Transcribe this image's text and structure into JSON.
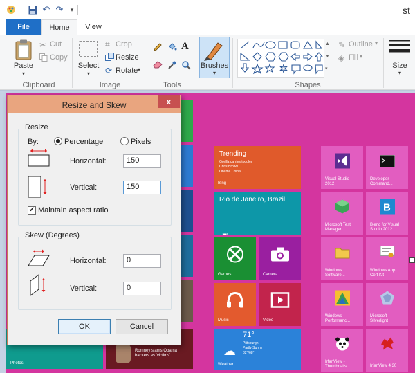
{
  "window": {
    "title": "st"
  },
  "tabs": {
    "file": "File",
    "home": "Home",
    "view": "View"
  },
  "ribbon": {
    "clipboard": {
      "paste": "Paste",
      "cut": "Cut",
      "copy": "Copy",
      "label": "Clipboard"
    },
    "image": {
      "select": "Select",
      "crop": "Crop",
      "resize": "Resize",
      "rotate": "Rotate",
      "label": "Image"
    },
    "tools": {
      "label": "Tools",
      "text_tool": "A"
    },
    "brushes": {
      "label": "Brushes"
    },
    "shapes": {
      "outline": "Outline",
      "fill": "Fill",
      "label": "Shapes"
    },
    "size": {
      "label": "Size"
    }
  },
  "dialog": {
    "title": "Resize and Skew",
    "close": "x",
    "resize": {
      "legend": "Resize",
      "by_label": "By:",
      "percentage_label": "Percentage",
      "pixels_label": "Pixels",
      "selected_mode": "Percentage",
      "horizontal_label": "Horizontal:",
      "horizontal_value": "150",
      "vertical_label": "Vertical:",
      "vertical_value": "150",
      "maintain_label": "Maintain aspect ratio",
      "maintain_checked": true
    },
    "skew": {
      "legend": "Skew (Degrees)",
      "horizontal_label": "Horizontal:",
      "horizontal_value": "0",
      "vertical_label": "Vertical:",
      "vertical_value": "0"
    },
    "ok": "OK",
    "cancel": "Cancel"
  },
  "start_tiles": {
    "trending": {
      "title": "Trending",
      "line1": "Gorilla carries toddler",
      "line2": "Chris Brown",
      "line3": "Obama China",
      "app": "Bing"
    },
    "travel": {
      "title": "Rio de Janeiro, Brazil"
    },
    "games": "Games",
    "camera": "Camera",
    "music": "Music",
    "video": "Video",
    "weather": {
      "temp": "71°",
      "city": "Pittsburgh",
      "line": "Partly Sunny",
      "line2": "82°/68°",
      "app": "Weather"
    },
    "photos": "Photos",
    "news": {
      "line1": "Romney slams Obama",
      "line2": "backers as 'victims'"
    },
    "vs2012": {
      "line1": "Visual Studio",
      "line2": "2012"
    },
    "devcmd": {
      "line1": "Developer",
      "line2": "Command..."
    },
    "mstest": {
      "line1": "Microsoft Test",
      "line2": "Manager"
    },
    "blend": {
      "line1": "Blend for Visual",
      "line2": "Studio 2012"
    },
    "winsw": {
      "line1": "Windows",
      "line2": "Software..."
    },
    "wack": {
      "line1": "Windows App",
      "line2": "Cert Kit"
    },
    "winperf": {
      "line1": "Windows",
      "line2": "Performanc..."
    },
    "silverlight": {
      "line1": "Microsoft",
      "line2": "Silverlight"
    },
    "irfanthumbs": {
      "line1": "IrfanView -",
      "line2": "Thumbnails"
    },
    "irfan": {
      "line1": "IrfanView 4.30"
    }
  },
  "colors": {
    "accent": "#1f6fc7",
    "dialog_title": "#e9a57f",
    "close": "#c75050",
    "start_bg": "#d4359f"
  }
}
